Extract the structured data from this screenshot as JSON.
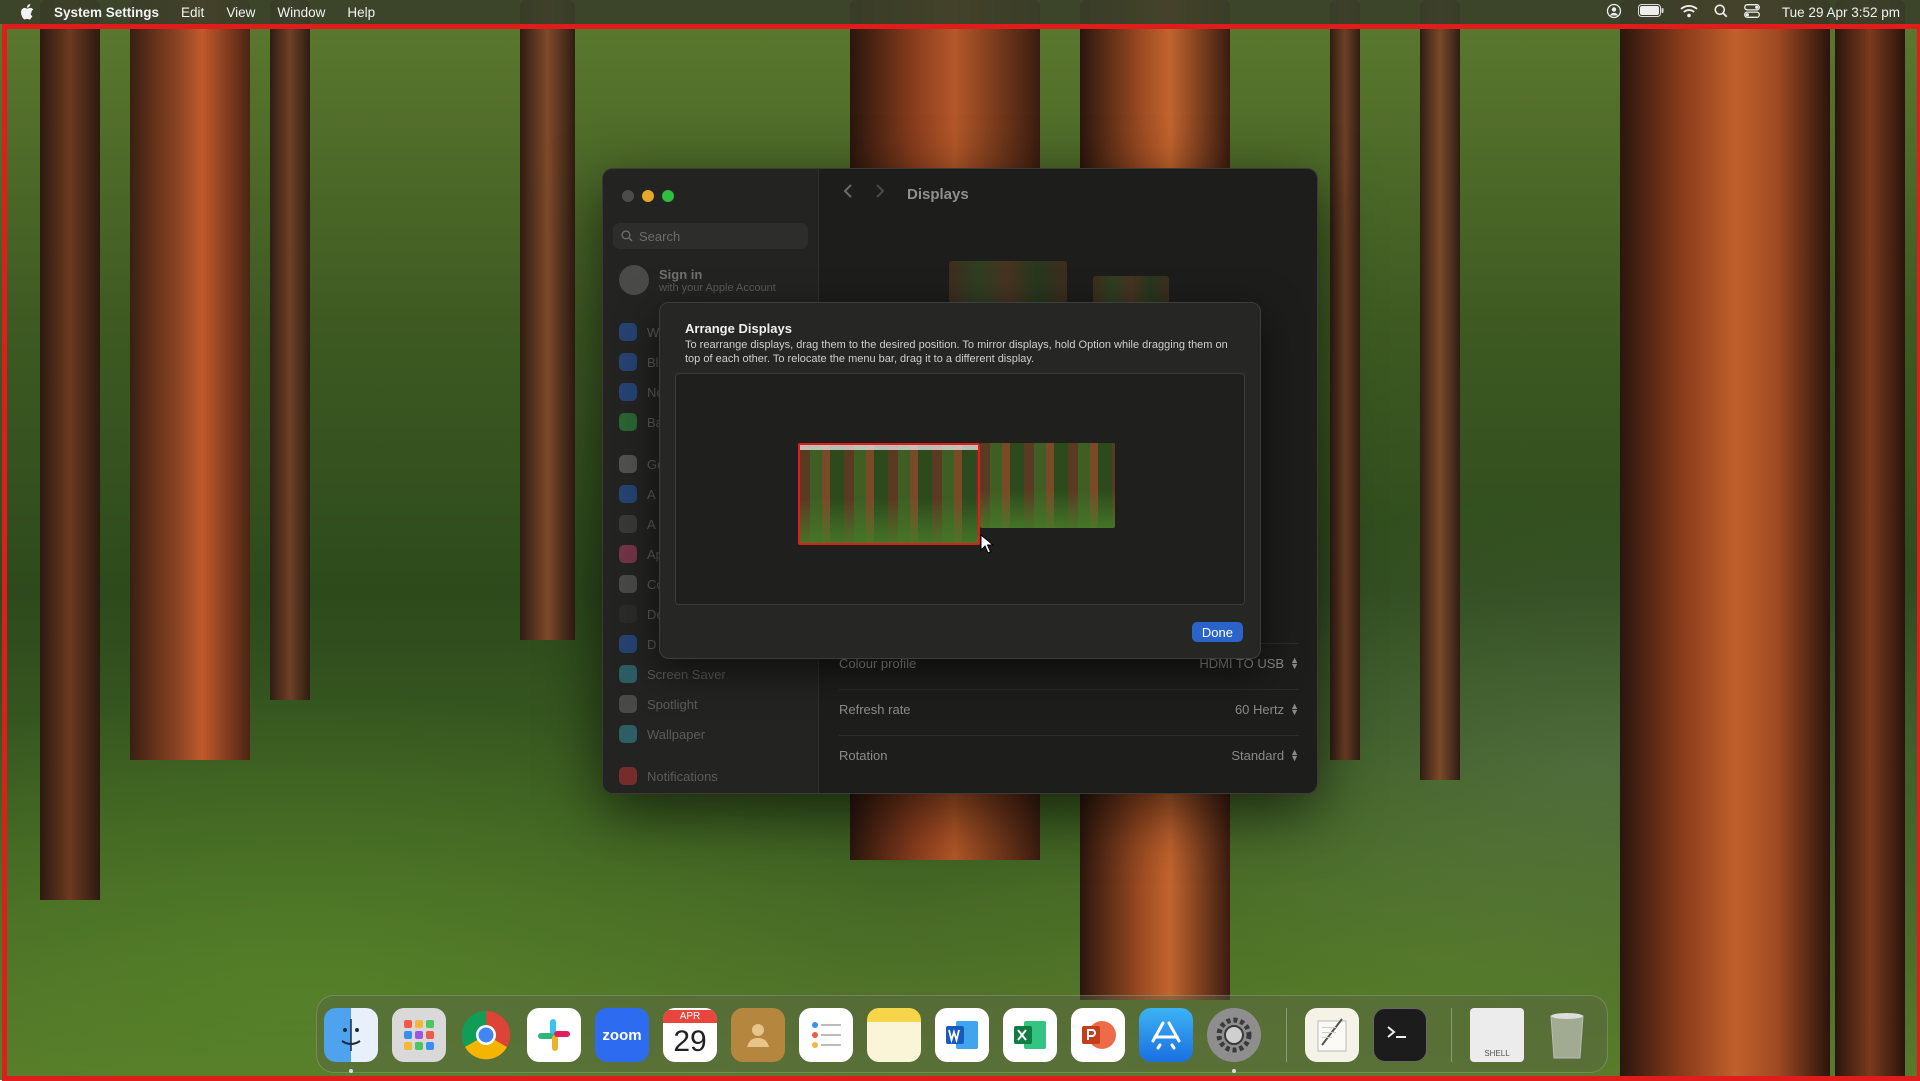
{
  "menubar": {
    "app_name": "System Settings",
    "menus": [
      "Edit",
      "View",
      "Window",
      "Help"
    ],
    "clock": "Tue 29 Apr  3:52 pm"
  },
  "window": {
    "title": "Displays",
    "search_placeholder": "Search",
    "signin_title": "Sign in",
    "signin_subtitle": "with your Apple Account",
    "sidebar_items": [
      "W",
      "Bl",
      "Ne",
      "Ba",
      "Ge",
      "A",
      "A",
      "Ap",
      "Co",
      "De",
      "D",
      "Screen Saver",
      "Spotlight",
      "Wallpaper",
      "Notifications"
    ],
    "rows": [
      {
        "label": "Colour profile",
        "value": "HDMI TO USB"
      },
      {
        "label": "Refresh rate",
        "value": "60 Hertz"
      },
      {
        "label": "Rotation",
        "value": "Standard"
      }
    ]
  },
  "sheet": {
    "title": "Arrange Displays",
    "description": "To rearrange displays, drag them to the desired position. To mirror displays, hold Option while dragging them on top of each other. To relocate the menu bar, drag it to a different display.",
    "done_label": "Done"
  },
  "dock": {
    "calendar_month": "APR",
    "calendar_day": "29",
    "zoom_label": "zoom",
    "shell_label": "SHELL",
    "apps": [
      "finder-icon",
      "launchpad-icon",
      "chrome-icon",
      "slack-icon",
      "zoom-icon",
      "calendar-icon",
      "contacts-icon",
      "reminders-icon",
      "notes-icon",
      "word-icon",
      "excel-icon",
      "powerpoint-icon",
      "app-store-icon",
      "system-settings-icon",
      "textedit-icon",
      "terminal-icon",
      "shell-file-icon",
      "trash-icon"
    ]
  },
  "colors": {
    "accent": "#2a64c8",
    "highlight_frame": "#e21b1b"
  }
}
